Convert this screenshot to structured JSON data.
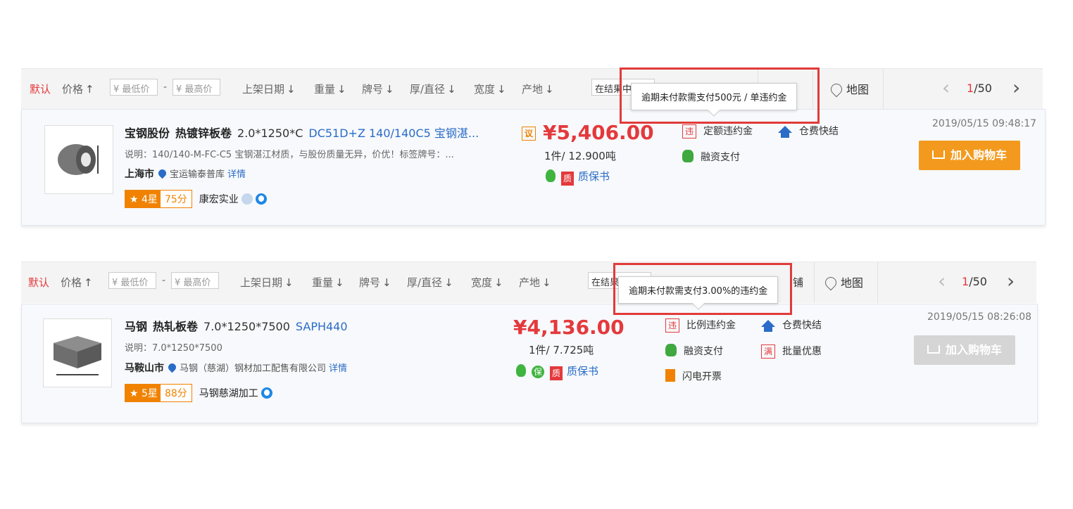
{
  "sortbar": {
    "default": "默认",
    "price": "价格",
    "min_price_placeholder": "¥ 最低价",
    "max_price_placeholder": "¥ 最高价",
    "dash": "-",
    "listing_date": "上架日期",
    "weight": "重量",
    "brand": "牌号",
    "thickness": "厚/直径",
    "width": "宽度",
    "origin": "产地",
    "search_in_results": "在结果中",
    "shop": "铺",
    "map": "地图",
    "page_current": "1",
    "page_total": "/50"
  },
  "products": [
    {
      "company": "宝钢股份",
      "name": "热镀锌板卷",
      "spec": "2.0*1250*C",
      "grade": "DC51D+Z 140/140C5 宝钢湛...",
      "desc": "说明：140/140-M-FC-C5 宝钢湛江材质，与股份质量无异，价优！标签牌号：...",
      "city": "上海市",
      "warehouse": "宝运输泰普库",
      "detail": "详情",
      "stars": "4星",
      "score": "75分",
      "seller": "康宏实业",
      "negotiable": "议",
      "price": "¥5,406.00",
      "qty": "1件/ 12.900吨",
      "quality_cert": "质保书",
      "svc_penalty": "定额违约金",
      "svc_storage": "仓费快结",
      "svc_finance": "融资支付",
      "time": "2019/05/15 09:48:17",
      "cart": "加入购物车",
      "tooltip": "逾期未付款需支付500元 / 单违约金"
    },
    {
      "company": "马钢",
      "name": "热轧板卷",
      "spec": "7.0*1250*7500",
      "grade": "SAPH440",
      "desc": "说明：7.0*1250*7500",
      "city": "马鞍山市",
      "warehouse": "马钢（慈湖）钢材加工配售有限公司",
      "detail": "详情",
      "stars": "5星",
      "score": "88分",
      "seller": "马钢慈湖加工",
      "price": "¥4,136.00",
      "qty": "1件/ 7.725吨",
      "quality_cert": "质保书",
      "svc_penalty": "比例违约金",
      "svc_storage": "仓费快结",
      "svc_finance": "融资支付",
      "svc_bulk": "批量优惠",
      "svc_invoice": "闪电开票",
      "time": "2019/05/15 08:26:08",
      "cart": "加入购物车",
      "tooltip": "逾期未付款需支付3.00%的违约金"
    }
  ],
  "icon_labels": {
    "penalty": "违",
    "bulk": "满",
    "quality": "质",
    "guarantee": "保"
  }
}
